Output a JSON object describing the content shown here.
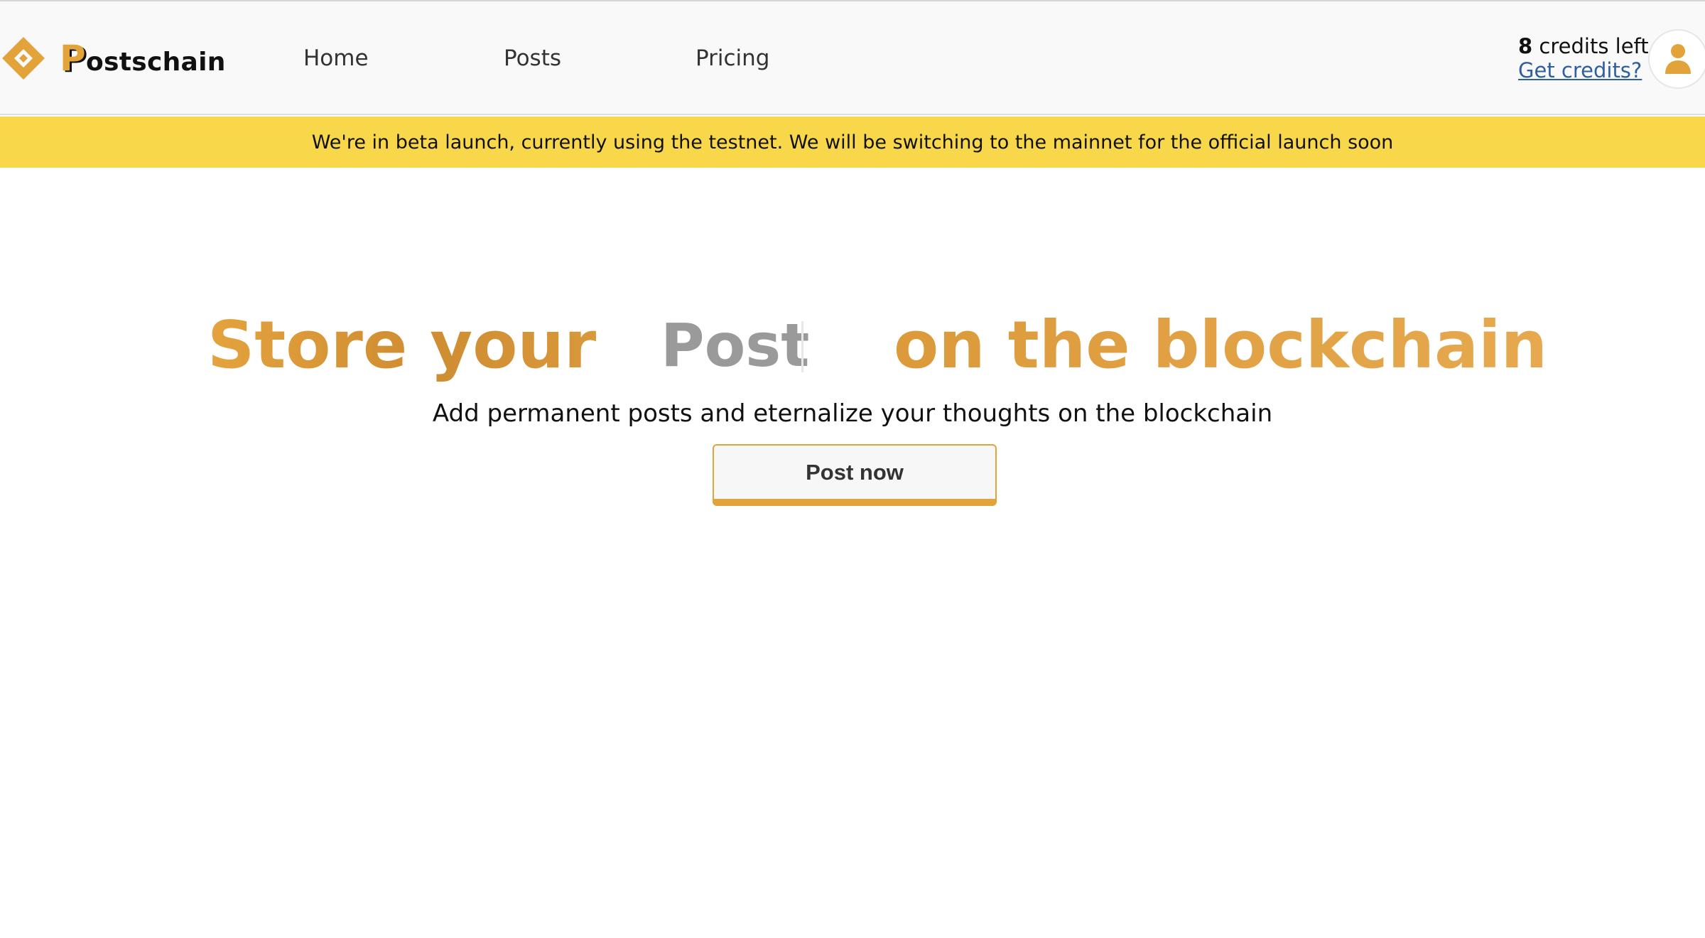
{
  "header": {
    "brand": {
      "initial": "P",
      "rest": "ostschain",
      "logo_icon": "diamond-logo-icon"
    },
    "nav": [
      {
        "label": "Home"
      },
      {
        "label": "Posts"
      },
      {
        "label": "Pricing"
      }
    ],
    "credits": {
      "count": "8",
      "suffix": " credits left",
      "link_label": "Get credits?"
    },
    "avatar_icon": "user-icon"
  },
  "banner": {
    "text": "We're in beta launch, currently using the testnet. We will be switching to the mainnet for the official launch soon"
  },
  "hero": {
    "title_prefix": "Store your",
    "title_word": "Post",
    "title_suffix": "on the blockchain",
    "subtitle": "Add permanent posts and eternalize your thoughts on the blockchain",
    "cta_label": "Post now"
  },
  "colors": {
    "accent": "#e3a33b",
    "banner": "#f8d84a",
    "link": "#2f5f9e",
    "typed_word": "#9a9a9a"
  }
}
